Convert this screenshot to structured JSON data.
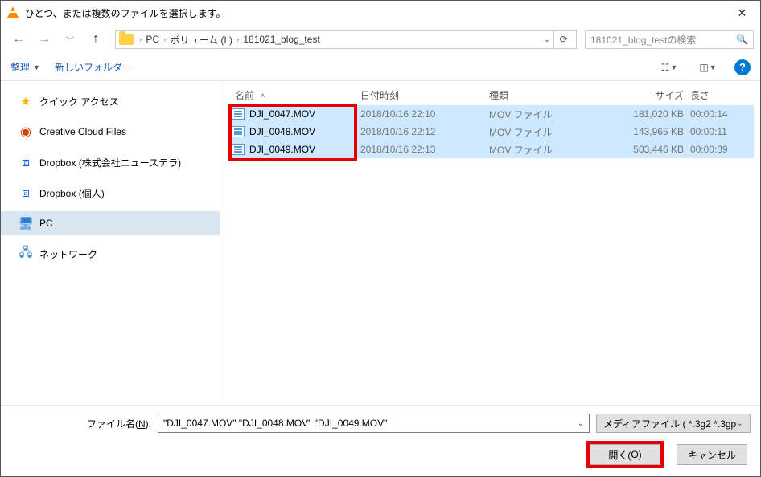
{
  "title": "ひとつ、または複数のファイルを選択します。",
  "breadcrumb": [
    "PC",
    "ボリューム (I:)",
    "181021_blog_test"
  ],
  "search_placeholder": "181021_blog_testの検索",
  "toolbar": {
    "organize": "整理",
    "new_folder": "新しいフォルダー"
  },
  "columns": {
    "name": "名前",
    "date": "日付時刻",
    "type": "種類",
    "size": "サイズ",
    "length": "長さ"
  },
  "sidebar": [
    {
      "label": "クイック アクセス",
      "icon": "star"
    },
    {
      "label": "Creative Cloud Files",
      "icon": "cc"
    },
    {
      "label": "Dropbox (株式会社ニューステラ)",
      "icon": "dropbox"
    },
    {
      "label": "Dropbox (個人)",
      "icon": "dropbox"
    },
    {
      "label": "PC",
      "icon": "pc",
      "selected": true
    },
    {
      "label": "ネットワーク",
      "icon": "net"
    }
  ],
  "files": [
    {
      "name": "DJI_0047.MOV",
      "date": "2018/10/16 22:10",
      "type": "MOV ファイル",
      "size": "181,020 KB",
      "length": "00:00:14"
    },
    {
      "name": "DJI_0048.MOV",
      "date": "2018/10/16 22:12",
      "type": "MOV ファイル",
      "size": "143,965 KB",
      "length": "00:00:11"
    },
    {
      "name": "DJI_0049.MOV",
      "date": "2018/10/16 22:13",
      "type": "MOV ファイル",
      "size": "503,446 KB",
      "length": "00:00:39"
    }
  ],
  "footer": {
    "filename_label_pre": "ファイル名(",
    "filename_label_key": "N",
    "filename_label_post": "):",
    "filename_value": "\"DJI_0047.MOV\" \"DJI_0048.MOV\" \"DJI_0049.MOV\"",
    "filter": "メディアファイル ( *.3g2 *.3gp *.3gp",
    "open_pre": "開く(",
    "open_key": "O",
    "open_post": ")",
    "cancel": "キャンセル"
  }
}
